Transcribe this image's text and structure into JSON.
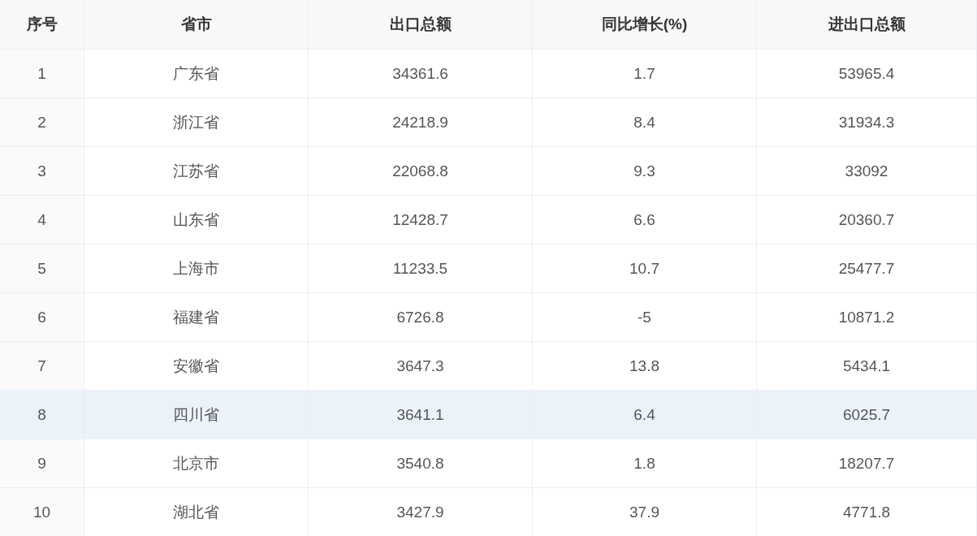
{
  "table": {
    "columns": [
      "序号",
      "省市",
      "出口总额",
      "同比增长(%)",
      "进出口总额"
    ],
    "rows": [
      {
        "cells": [
          "1",
          "广东省",
          "34361.6",
          "1.7",
          "53965.4"
        ],
        "selected": false
      },
      {
        "cells": [
          "2",
          "浙江省",
          "24218.9",
          "8.4",
          "31934.3"
        ],
        "selected": false
      },
      {
        "cells": [
          "3",
          "江苏省",
          "22068.8",
          "9.3",
          "33092"
        ],
        "selected": false
      },
      {
        "cells": [
          "4",
          "山东省",
          "12428.7",
          "6.6",
          "20360.7"
        ],
        "selected": false
      },
      {
        "cells": [
          "5",
          "上海市",
          "11233.5",
          "10.7",
          "25477.7"
        ],
        "selected": false
      },
      {
        "cells": [
          "6",
          "福建省",
          "6726.8",
          "-5",
          "10871.2"
        ],
        "selected": false
      },
      {
        "cells": [
          "7",
          "安徽省",
          "3647.3",
          "13.8",
          "5434.1"
        ],
        "selected": false
      },
      {
        "cells": [
          "8",
          "四川省",
          "3641.1",
          "6.4",
          "6025.7"
        ],
        "selected": true
      },
      {
        "cells": [
          "9",
          "北京市",
          "3540.8",
          "1.8",
          "18207.7"
        ],
        "selected": false
      },
      {
        "cells": [
          "10",
          "湖北省",
          "3427.9",
          "37.9",
          "4771.8"
        ],
        "selected": false
      }
    ]
  }
}
